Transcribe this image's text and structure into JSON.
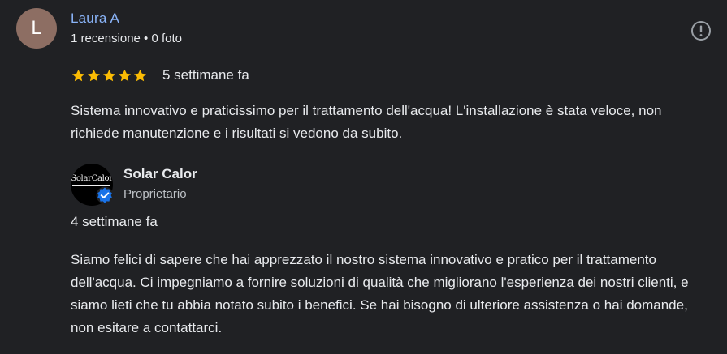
{
  "review": {
    "avatar_letter": "L",
    "avatar_color": "#8d6e63",
    "author_name": "Laura A",
    "author_meta": "1 recensione • 0 foto",
    "rating": 5,
    "rating_max": 5,
    "star_color": "#fbbc04",
    "date": "5 settimane fa",
    "text": "Sistema innovativo e praticissimo per il trattamento dell'acqua! L'installazione è stata veloce, non richiede manutenzione e i risultati si vedono da subito.",
    "report_icon": "report-icon"
  },
  "owner_reply": {
    "logo_text": "SolarCalor",
    "verified_icon": "verified-badge-icon",
    "verified_color": "#1a73e8",
    "owner_name": "Solar Calor",
    "owner_role": "Proprietario",
    "date": "4 settimane fa",
    "text": "Siamo felici di sapere che hai apprezzato il nostro sistema innovativo e pratico per il trattamento dell'acqua. Ci impegniamo a fornire soluzioni di qualità che migliorano l'esperienza dei nostri clienti, e siamo lieti che tu abbia notato subito i benefici. Se hai bisogno di ulteriore assistenza o hai domande, non esitare a contattarci."
  }
}
